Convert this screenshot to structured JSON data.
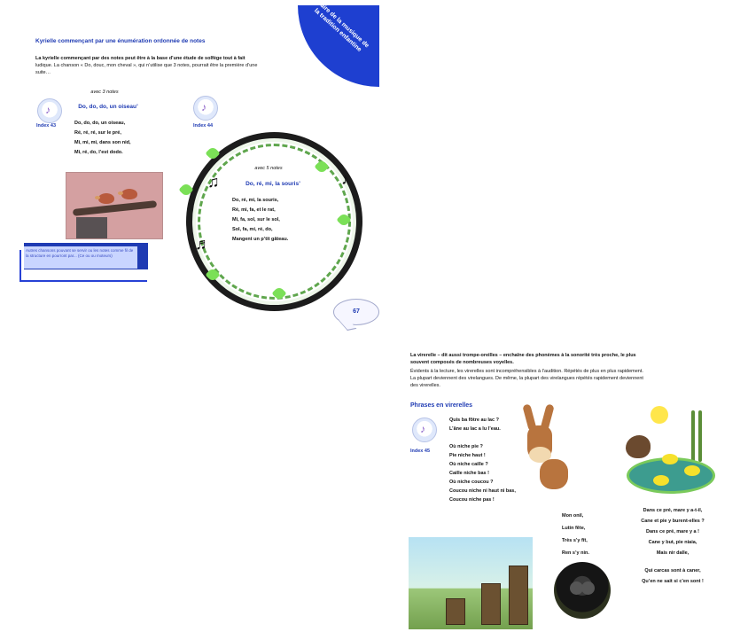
{
  "left_page": {
    "corner_banner": "Faire de la musique de la tradition enfantine",
    "section_title": "Kyrielle commençant par une énumération ordonnée de notes",
    "intro_line1": "La kyrielle commençant par des notes peut être à la base d’une étude de solfège tout à fait",
    "intro_line2": "ludique. La chanson « Do, douc, mon cheval », qui n’utilise que 3 notes, pourrait être la première d’une",
    "intro_line3": "suite…",
    "first_song": {
      "subtitle": "avec 3 notes",
      "title": "Do, do, do, un oiseau’",
      "index_label": "Index 43",
      "lines": [
        "Do, do, do, un oiseau,",
        "Ré, ré, ré, sur le pré,",
        "Mi, mi, mi, dans son nid,",
        "Mi, ré, do, l’est dodo."
      ]
    },
    "second_song": {
      "subtitle": "avec 5 notes",
      "title": "Do, ré, mi, la souris’",
      "index_label": "Index 44",
      "lines": [
        "Do, ré, mi, la souris,",
        "Ré, mi, fa, et le rat,",
        "Mi, fa, sol, sur le sol,",
        "Sol, fa, mi, ré, do,",
        "Mangent un p’tit gâteau."
      ]
    },
    "note_box_text": "Autres chansons pouvant se servir ou les notes comme fil de la structure en pourront par... (Ce ou ou moteurs)",
    "page_number": "67"
  },
  "right_page": {
    "intro_line1": "La virerelle – dit aussi trompe-oreilles – enchaîne des phonèmes à la sonorité très proche, le plus",
    "intro_line2": "souvent composés de nombreuses voyelles.",
    "intro_line3": "Évidents à la lecture, les virerelles sont incompréhensibles à l’audition. Répétés de plus en plus rapidement.",
    "intro_line4": "La plupart deviennent des virelangues. De même, la plupart des virelangues répétés rapidement deviennent",
    "intro_line5": "des virerelles.",
    "section_title": "Phrases en virerelles",
    "index_label": "Index 45",
    "lines_left": [
      "Quis ba fôtre au lac ?",
      "L’âne au lac a lu l’eau.",
      "Où niche pie ?",
      "Pie niche haut !",
      "Où niche caille ?",
      "Caille niche bas !",
      "Où niche coucou ?",
      "Coucou niche ni haut ni bas,",
      "Coucou niche pas !"
    ],
    "lines_center": [
      "Mon onil,",
      "Lutin fête,",
      "Très s’y fît,",
      "Ren s’y nin."
    ],
    "lines_right": [
      "Dans ce pré, mare y a-t-il,",
      "Cane et pie y burent-elles ?",
      "Dans ce pré, mare y a !",
      "Cane y but, pie niaia,",
      "Mais nir dalle,",
      "Qui carcas sont à caner,",
      "Qu’en ne sait si c’en sont !"
    ]
  }
}
